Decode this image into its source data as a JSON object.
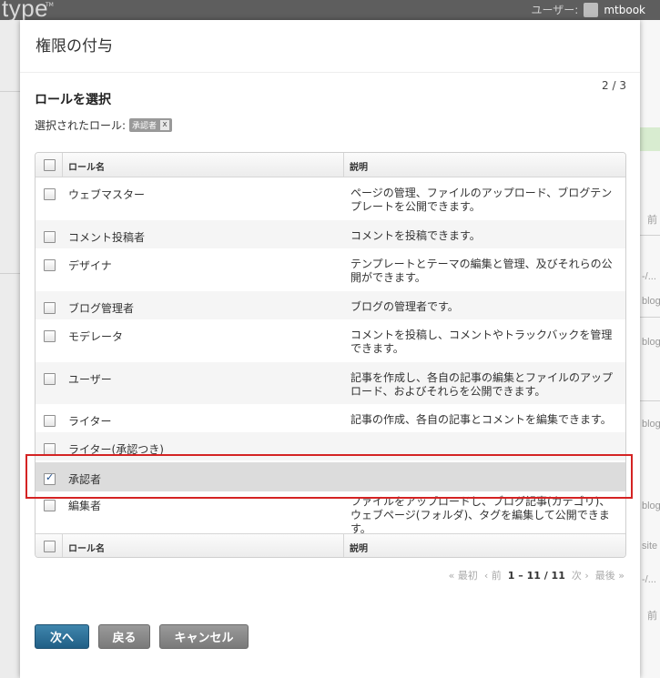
{
  "app": {
    "brand": "type",
    "brand_tm": "TM",
    "user_label": "ユーザー:",
    "user_name": "mtbook"
  },
  "background_fragments": [
    "前",
    "-/...",
    "blog",
    "blog",
    "blog",
    "blog",
    "site",
    "-/...",
    "前"
  ],
  "modal": {
    "title": "権限の付与",
    "step": "2 / 3",
    "section_title": "ロールを選択",
    "selected_label": "選択されたロール:",
    "selected_chip": "承認者",
    "chip_remove": "x"
  },
  "table": {
    "col_name": "ロール名",
    "col_desc": "説明",
    "rows": [
      {
        "name": "ウェブマスター",
        "desc": "ページの管理、ファイルのアップロード、ブログテンプレートを公開できます。"
      },
      {
        "name": "コメント投稿者",
        "desc": "コメントを投稿できます。"
      },
      {
        "name": "デザイナ",
        "desc": "テンプレートとテーマの編集と管理、及びそれらの公開ができます。"
      },
      {
        "name": "ブログ管理者",
        "desc": "ブログの管理者です。"
      },
      {
        "name": "モデレータ",
        "desc": "コメントを投稿し、コメントやトラックバックを管理できます。"
      },
      {
        "name": "ユーザー",
        "desc": "記事を作成し、各自の記事の編集とファイルのアップロード、およびそれらを公開できます。"
      },
      {
        "name": "ライター",
        "desc": "記事の作成、各自の記事とコメントを編集できます。"
      },
      {
        "name": "ライター(承認つき)",
        "desc": ""
      },
      {
        "name": "承認者",
        "desc": ""
      },
      {
        "name": "編集者",
        "desc": "ファイルをアップロードし、ブログ記事(カテゴリ)、ウェブページ(フォルダ)、タグを編集して公開できます。"
      }
    ]
  },
  "pager": {
    "first": "« 最初",
    "prev": "‹ 前",
    "range": "1 – 11 / 11",
    "next": "次 ›",
    "last": "最後 »"
  },
  "buttons": {
    "next": "次へ",
    "back": "戻る",
    "cancel": "キャンセル"
  }
}
